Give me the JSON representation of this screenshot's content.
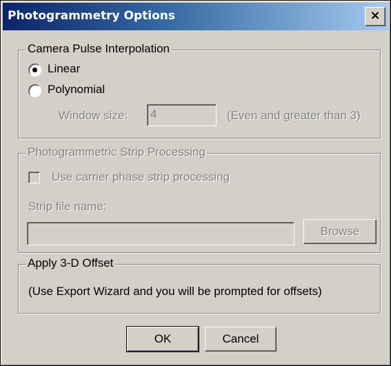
{
  "window": {
    "title": "Photogrammetry Options",
    "close_label": "×"
  },
  "camera_pulse": {
    "legend": "Camera Pulse Interpolation",
    "options": [
      {
        "label": "Linear",
        "selected": true
      },
      {
        "label": "Polynomial",
        "selected": false
      }
    ],
    "window_size_label": "Window size:",
    "window_size_value": "4",
    "window_size_hint": "(Even and greater than 3)"
  },
  "strip_processing": {
    "legend": "Photogrammetric Strip Processing",
    "checkbox_label": "Use carrier phase strip processing",
    "checkbox_checked": false,
    "strip_file_label": "Strip file name:",
    "strip_file_value": "",
    "browse_label": "Browse"
  },
  "offset": {
    "legend": "Apply 3-D Offset",
    "message": "(Use Export Wizard and you will be prompted for offsets)"
  },
  "buttons": {
    "ok": "OK",
    "cancel": "Cancel"
  }
}
